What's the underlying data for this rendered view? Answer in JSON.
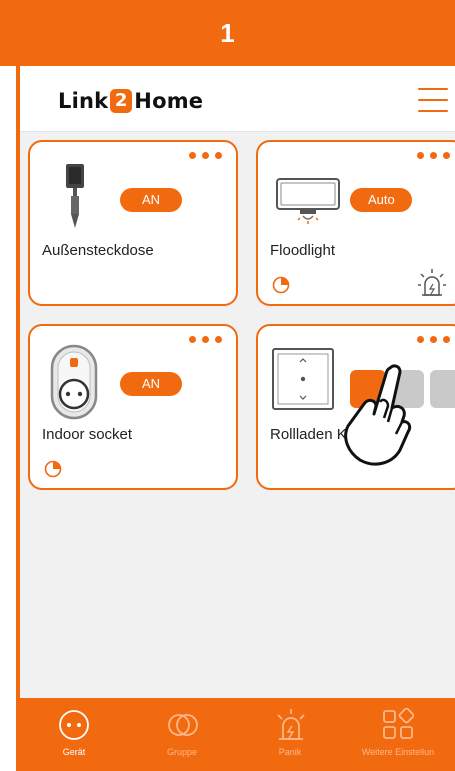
{
  "step_number": "1",
  "app": {
    "logo": {
      "part1": "Link",
      "badge": "2",
      "part2": "Home"
    }
  },
  "devices": [
    {
      "name": "Außensteckdose",
      "status": "AN",
      "icon": "outdoor-socket-icon",
      "has_timer": false
    },
    {
      "name": "Floodlight",
      "status": "Auto",
      "icon": "floodlight-icon",
      "has_timer": true,
      "extra_icon": "alarm-siren-icon"
    },
    {
      "name": "Indoor socket",
      "status": "AN",
      "icon": "indoor-socket-icon",
      "has_timer": true
    },
    {
      "name": "Rollladen Küche",
      "status": "",
      "icon": "shutter-switch-icon",
      "has_timer": false
    }
  ],
  "tabs": [
    {
      "label": "Gerät",
      "icon": "device-socket-icon",
      "active": true
    },
    {
      "label": "Gruppe",
      "icon": "group-rings-icon",
      "active": false
    },
    {
      "label": "Panik",
      "icon": "panic-siren-icon",
      "active": false
    },
    {
      "label": "Weitere Einstellun",
      "icon": "settings-grid-icon",
      "active": false
    }
  ],
  "colors": {
    "accent": "#f26a10",
    "background": "#f1f1f2"
  }
}
